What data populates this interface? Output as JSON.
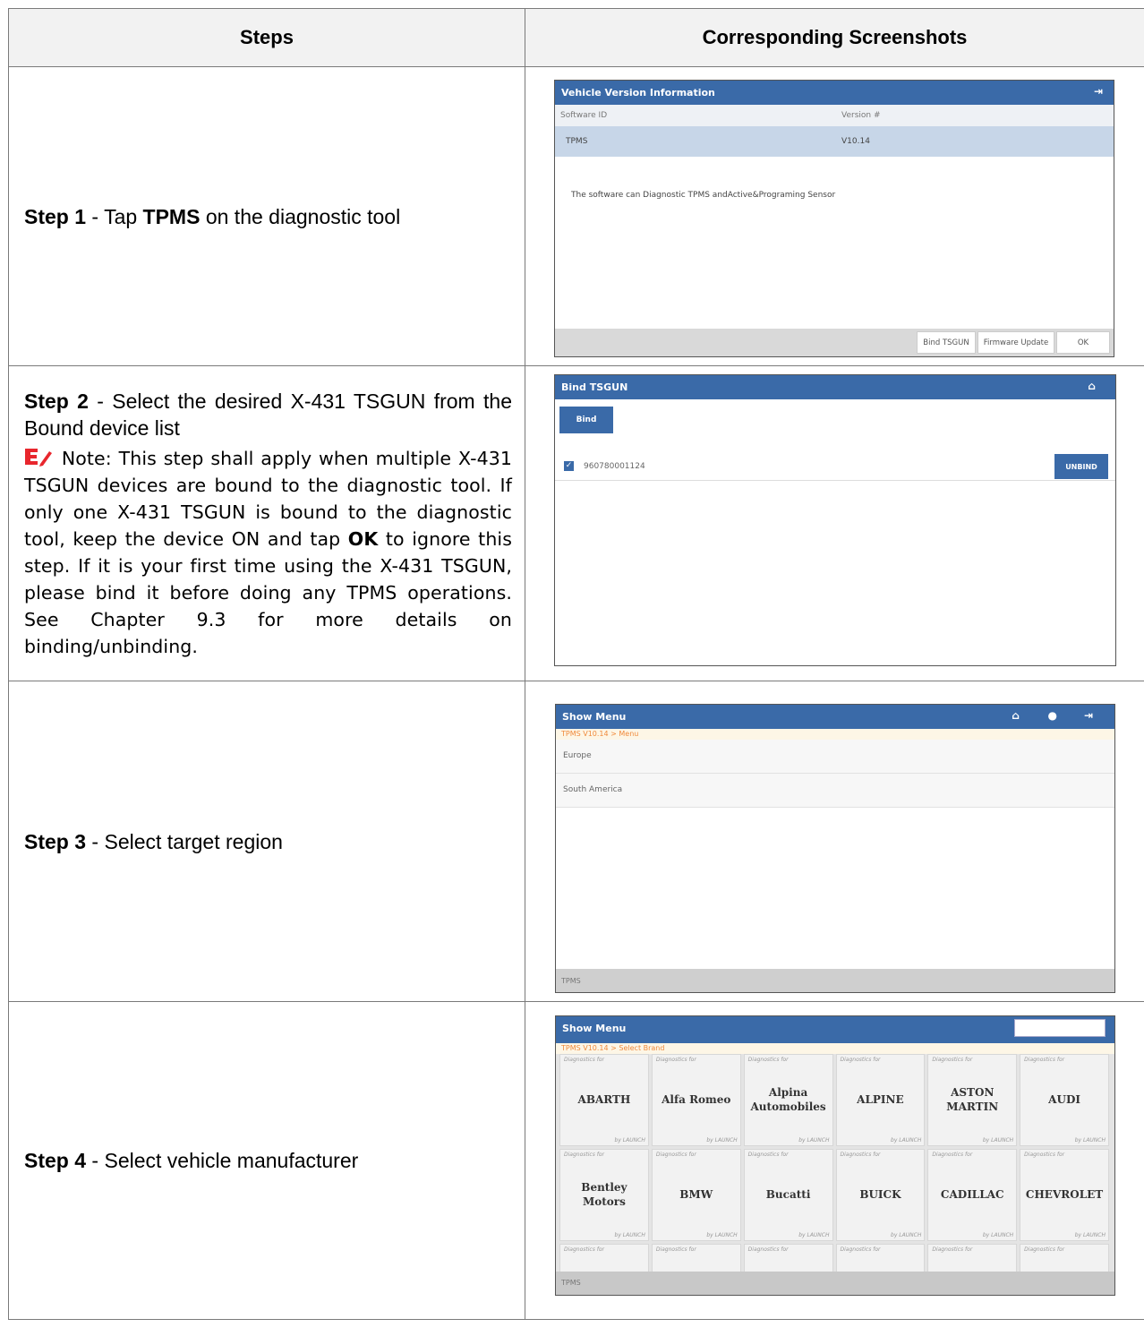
{
  "table": {
    "header_steps": "Steps",
    "header_screenshots": "Corresponding Screenshots"
  },
  "step1": {
    "label": "Step 1",
    "sep": " - ",
    "pre": "Tap ",
    "bold": "TPMS",
    "post": " on the diagnostic tool"
  },
  "step2": {
    "label": "Step 2",
    "sep": " - ",
    "text": "Select the desired X-431 TSGUN from the Bound device list",
    "note_label": "Note",
    "note_colon": ":",
    "note_text_1": " This step shall apply when multiple X-431 TSGUN devices are bound to the diagnostic tool. If only one X-431 TSGUN is bound to the diagnostic tool, keep the device ON and tap ",
    "note_ok": "OK",
    "note_text_2": " to ignore this step. If it is your first time using the X-431 TSGUN, please bind it before doing any TPMS operations. See Chapter 9.3 for more details on binding/unbinding."
  },
  "step3": {
    "label": "Step 3",
    "sep": " - ",
    "text": "Select target region"
  },
  "step4": {
    "label": "Step 4",
    "sep": " - ",
    "text": "Select vehicle manufacturer"
  },
  "screen1": {
    "title": "Vehicle Version Information",
    "exit_icon": "exit-icon",
    "col_software": "Software ID",
    "col_version": "Version #",
    "row_software": "TPMS",
    "row_version": "V10.14",
    "description": "The software can Diagnostic TPMS andActive&Programing Sensor",
    "btn_bind": "Bind TSGUN",
    "btn_firmware": "Firmware Update",
    "btn_ok": "OK"
  },
  "screen2": {
    "title": "Bind TSGUN",
    "home_icon": "home-icon",
    "bind_button": "Bind",
    "serial": "960780001124",
    "unbind_button": "UNBIND"
  },
  "screen3": {
    "title": "Show Menu",
    "breadcrumb": "TPMS V10.14 > Menu",
    "items": [
      "Europe",
      "South America"
    ],
    "footer": "TPMS"
  },
  "screen4": {
    "title": "Show Menu",
    "breadcrumb": "TPMS V10.14 > Select Brand",
    "tile_header": "Diagnostics for",
    "tile_footer": "by LAUNCH",
    "brands": [
      "ABARTH",
      "Alfa Romeo",
      "Alpina Automobiles",
      "ALPINE",
      "ASTON MARTIN",
      "AUDI",
      "Bentley Motors",
      "BMW",
      "Bucatti",
      "BUICK",
      "CADILLAC",
      "CHEVROLET"
    ],
    "footer": "TPMS"
  },
  "colors": {
    "titlebar": "#3a6aa8",
    "note_icon": "#e8262d",
    "breadcrumb": "#f08a3c"
  }
}
